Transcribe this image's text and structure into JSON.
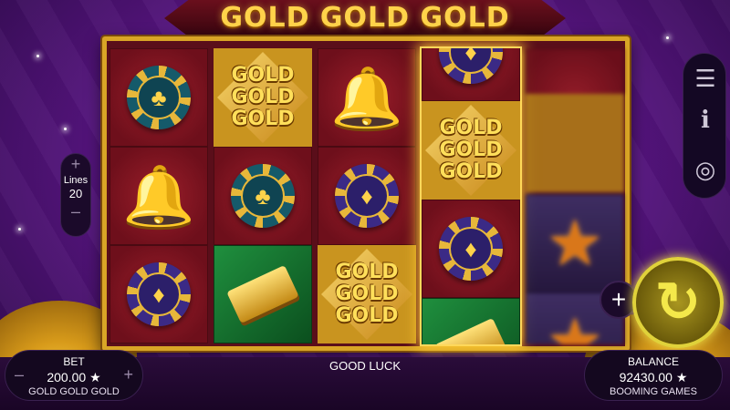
{
  "game": {
    "title": "GOLD GOLD GOLD"
  },
  "reels": [
    [
      "chip-club",
      "gold-gold-gold",
      "bell",
      "gold-gold-gold"
    ],
    [
      "bell",
      "chip-club",
      "chip-diamond"
    ],
    [
      "chip-diamond",
      "gold-bar",
      "gold-gold-gold"
    ]
  ],
  "gold_words": [
    "GOLD",
    "GOLD",
    "GOLD"
  ],
  "chip_glyphs": {
    "club": "♣",
    "diamond": "♦"
  },
  "lines": {
    "plus": "+",
    "label": "Lines",
    "value": "20",
    "minus": "–"
  },
  "side_menu": {
    "menu_icon": "☰",
    "info_icon": "i",
    "coins_icon": "◎"
  },
  "bet": {
    "label": "BET",
    "value": "200.00 ★",
    "game_name": "GOLD GOLD GOLD",
    "minus": "–",
    "plus": "+"
  },
  "message": "GOOD LUCK",
  "balance": {
    "label": "BALANCE",
    "value": "92430.00 ★",
    "provider": "BOOMING GAMES"
  },
  "controls": {
    "plus": "+",
    "spin": "↻"
  }
}
